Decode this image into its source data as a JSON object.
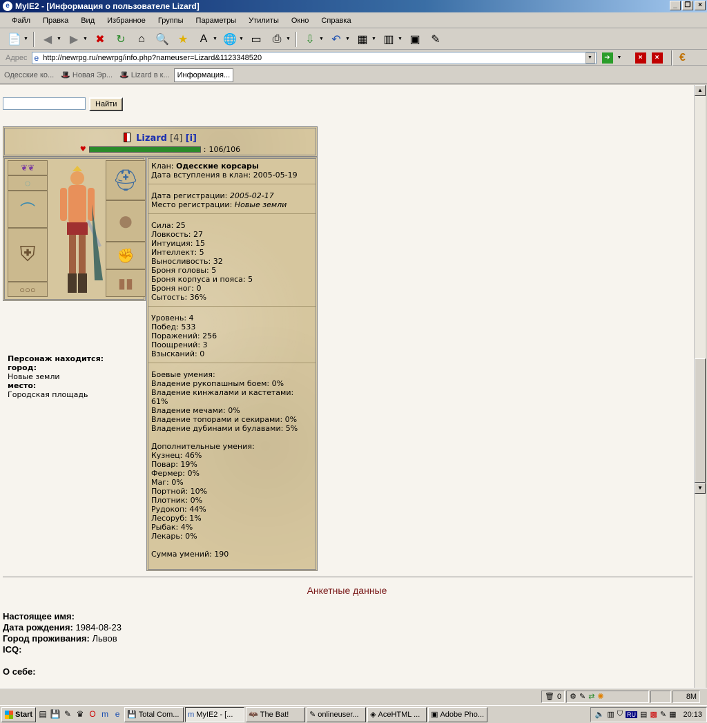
{
  "window": {
    "title": "MyIE2 - [Информация о пользователе Lizard]"
  },
  "menu": [
    "Файл",
    "Правка",
    "Вид",
    "Избранное",
    "Группы",
    "Параметры",
    "Утилиты",
    "Окно",
    "Справка"
  ],
  "address": {
    "label": "Адрес",
    "url": "http://newrpg.ru/newrpg/info.php?nameuser=Lizard&1123348520"
  },
  "tabs": [
    "Одесские ко...",
    "Новая Эр...",
    "Lizard в к...",
    "Информация..."
  ],
  "search": {
    "button": "Найти",
    "value": ""
  },
  "character": {
    "name": "Lizard",
    "level": "[4]",
    "info_link": "[i]",
    "hp_text": "106/106",
    "hp_fraction": 1.0
  },
  "clan_block": [
    "Клан:",
    "Одесские корсары",
    "Дата вступления в клан: 2005-05-19"
  ],
  "reg_block": {
    "date_label": "Дата регистрации:",
    "date": "2005-02-17",
    "place_label": "Место регистрации:",
    "place": "Новые земли"
  },
  "stats": [
    "Сила: 25",
    "Ловкость: 27",
    "Интуиция: 15",
    "Интеллект: 5",
    "Выносливость: 32",
    "Броня головы: 5",
    "Броня корпуса и пояса: 5",
    "Броня ног: 0",
    "Сытость: 36%"
  ],
  "record": [
    "Уровень: 4",
    "Побед: 533",
    "Поражений: 256",
    "Поощрений: 3",
    "Взысканий: 0"
  ],
  "combat": [
    "Боевые умения:",
    "Владение рукопашным боем: 0%",
    "Владение кинжалами и кастетами: 61%",
    "Владение мечами: 0%",
    "Владение топорами и секирами: 0%",
    "Владение дубинами и булавами: 5%"
  ],
  "extra": [
    "Дополнительные умения:",
    "Кузнец: 46%",
    "Повар: 19%",
    "Фермер: 0%",
    "Маг: 0%",
    "Портной: 10%",
    "Плотник: 0%",
    "Рудокоп: 44%",
    "Лесоруб: 1%",
    "Рыбак: 4%",
    "Лекарь: 0%"
  ],
  "skills_sum": "Сумма умений: 190",
  "location": {
    "title": "Персонаж находится:",
    "city_label": "город:",
    "city": "Новые земли",
    "place_label": "место:",
    "place": "Городская площадь"
  },
  "anketa": {
    "title": "Анкетные данные",
    "real_name_label": "Настоящее имя:",
    "real_name": "",
    "birth_label": "Дата рождения:",
    "birth": "1984-08-23",
    "city_label": "Город проживания:",
    "city": "Львов",
    "icq_label": "ICQ:",
    "icq": "",
    "about_label": "О себе:"
  },
  "statusbar": {
    "trash": "0",
    "mem": "8M"
  },
  "taskbar": {
    "start": "Start",
    "tasks": [
      "Total Com...",
      "MyIE2 - [...",
      "The Bat!",
      "onlineuser...",
      "AceHTML ...",
      "Adobe Pho..."
    ],
    "tray_lang": "RU",
    "clock": "20:13"
  }
}
